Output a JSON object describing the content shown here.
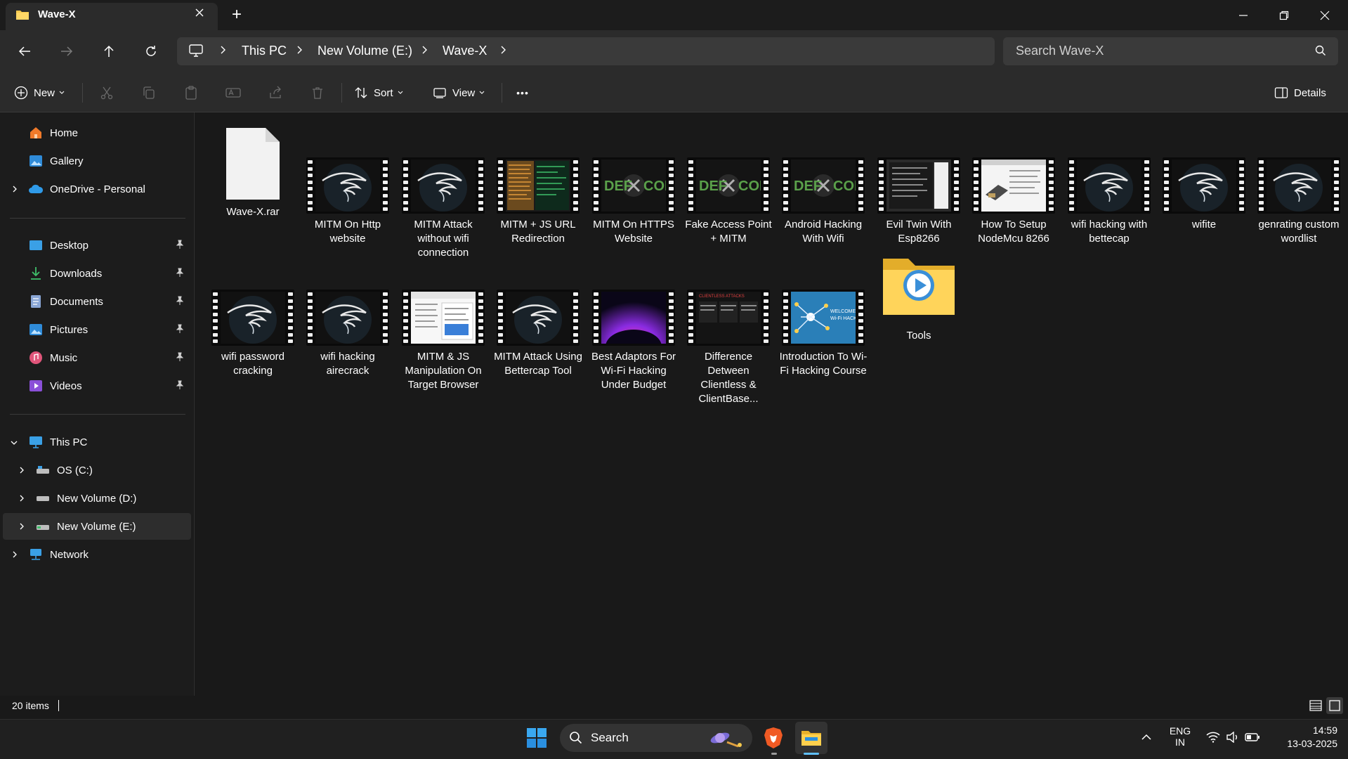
{
  "window": {
    "tab_title": "Wave-X",
    "new_tab": "+"
  },
  "breadcrumb": [
    "This PC",
    "New Volume (E:)",
    "Wave-X"
  ],
  "search": {
    "placeholder": "Search Wave-X"
  },
  "toolbar": {
    "new_label": "New",
    "sort_label": "Sort",
    "view_label": "View",
    "more_label": "•••",
    "details_label": "Details"
  },
  "sidebar": {
    "top": [
      {
        "label": "Home",
        "icon": "home-icon"
      },
      {
        "label": "Gallery",
        "icon": "gallery-icon"
      },
      {
        "label": "OneDrive - Personal",
        "icon": "cloud-icon"
      }
    ],
    "quick": [
      {
        "label": "Desktop",
        "icon": "desktop-icon"
      },
      {
        "label": "Downloads",
        "icon": "download-icon"
      },
      {
        "label": "Documents",
        "icon": "documents-icon"
      },
      {
        "label": "Pictures",
        "icon": "pictures-icon"
      },
      {
        "label": "Music",
        "icon": "music-icon"
      },
      {
        "label": "Videos",
        "icon": "videos-icon"
      }
    ],
    "pc": [
      {
        "label": "This PC",
        "icon": "pc-icon"
      },
      {
        "label": "OS (C:)",
        "icon": "drive-icon"
      },
      {
        "label": "New Volume (D:)",
        "icon": "drive-icon"
      },
      {
        "label": "New Volume (E:)",
        "icon": "drive-icon",
        "selected": true
      },
      {
        "label": "Network",
        "icon": "network-icon"
      }
    ]
  },
  "files": {
    "row1": [
      {
        "name": "Wave-X.rar",
        "kind": "doc"
      },
      {
        "name": "MITM On Http website",
        "kind": "video",
        "thumb": "kali"
      },
      {
        "name": "MITM Attack without wifi connection",
        "kind": "video",
        "thumb": "kali"
      },
      {
        "name": "MITM + JS URL Redirection",
        "kind": "video",
        "thumb": "terminal"
      },
      {
        "name": "MITM On HTTPS Website",
        "kind": "video",
        "thumb": "defcon"
      },
      {
        "name": "Fake Access Point + MITM",
        "kind": "video",
        "thumb": "defcon"
      },
      {
        "name": "Android Hacking With Wifi",
        "kind": "video",
        "thumb": "defcon"
      },
      {
        "name": "Evil Twin With Esp8266",
        "kind": "video",
        "thumb": "screen"
      },
      {
        "name": "How To Setup NodeMcu 8266",
        "kind": "video",
        "thumb": "web"
      },
      {
        "name": "wifi hacking with bettecap",
        "kind": "video",
        "thumb": "kali"
      },
      {
        "name": "wifite",
        "kind": "video",
        "thumb": "kali"
      },
      {
        "name": "genrating custom wordlist",
        "kind": "video",
        "thumb": "kali"
      }
    ],
    "row2": [
      {
        "name": "wifi password cracking",
        "kind": "video",
        "thumb": "kali"
      },
      {
        "name": "wifi hacking airecrack",
        "kind": "video",
        "thumb": "kali"
      },
      {
        "name": "MITM & JS Manipulation On Target Browser",
        "kind": "video",
        "thumb": "doc"
      },
      {
        "name": "MITM Attack Using Bettercap Tool",
        "kind": "video",
        "thumb": "kali"
      },
      {
        "name": "Best Adaptors For Wi-Fi Hacking Under Budget",
        "kind": "video",
        "thumb": "purple"
      },
      {
        "name": "Difference Detween Clientless & ClientBase...",
        "kind": "video",
        "thumb": "slides"
      },
      {
        "name": "Introduction To Wi-Fi Hacking Course",
        "kind": "video",
        "thumb": "intro"
      },
      {
        "name": "Tools",
        "kind": "folder"
      }
    ]
  },
  "thumb_text": {
    "defcon": "DEF CON",
    "slides_title": "CLIENTLESS ATTACKS",
    "intro_title": "WELCOME Wi-Fi HACKING"
  },
  "status": {
    "item_count": "20 items"
  },
  "taskbar": {
    "search_label": "Search",
    "lang_1": "ENG",
    "lang_2": "IN",
    "time": "14:59",
    "date": "13-03-2025"
  },
  "colors": {
    "background": "#191919",
    "chrome": "#2b2b2b",
    "accent": "#0078d4",
    "folder": "#f5c84c"
  }
}
